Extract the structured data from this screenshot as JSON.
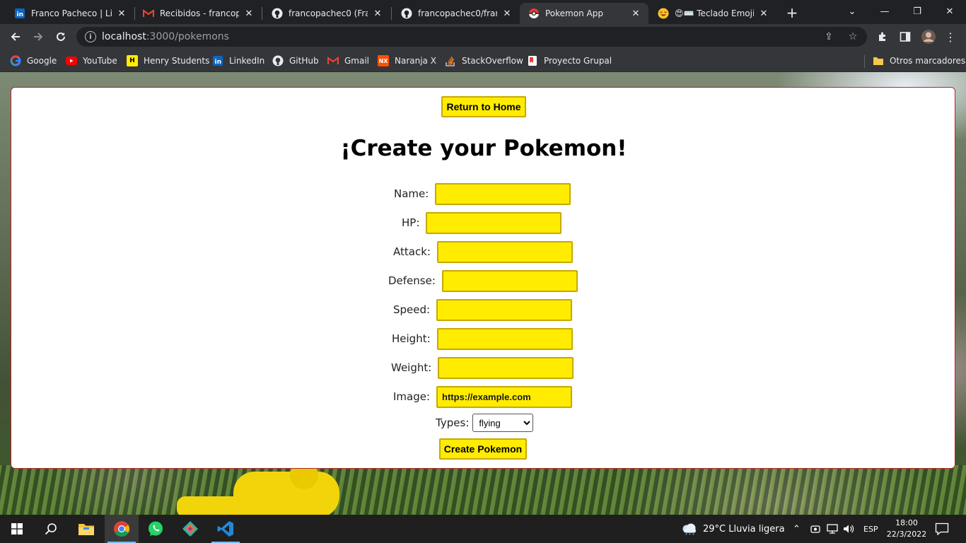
{
  "browser": {
    "tabs": [
      {
        "title": "Franco Pacheco | LinkedIn",
        "icon": "linkedin-icon",
        "active": false
      },
      {
        "title": "Recibidos - francopacheco",
        "icon": "gmail-icon",
        "active": false
      },
      {
        "title": "francopachec0 (Franco Pacheco)",
        "icon": "github-icon",
        "active": false
      },
      {
        "title": "francopachec0/francopachec0",
        "icon": "github-icon",
        "active": false
      },
      {
        "title": "Pokemon App",
        "icon": "pokeball-icon",
        "active": true
      },
      {
        "title": "😍⌨️ Teclado Emoji ¿",
        "icon": "emoji-icon",
        "active": false
      }
    ],
    "url": {
      "host": "localhost",
      "path": ":3000/pokemons"
    },
    "bookmarks": [
      {
        "label": "Google",
        "icon": "google-icon"
      },
      {
        "label": "YouTube",
        "icon": "youtube-icon"
      },
      {
        "label": "Henry Students",
        "icon": "henry-icon"
      },
      {
        "label": "LinkedIn",
        "icon": "linkedin-icon"
      },
      {
        "label": "GitHub",
        "icon": "github-icon"
      },
      {
        "label": "Gmail",
        "icon": "gmail-icon"
      },
      {
        "label": "Naranja X",
        "icon": "naranjax-icon"
      },
      {
        "label": "StackOverflow",
        "icon": "stackoverflow-icon"
      },
      {
        "label": "Proyecto Grupal",
        "icon": "bookmark-icon"
      }
    ],
    "other_bookmarks": "Otros marcadores"
  },
  "page": {
    "home_button": "Return to Home",
    "title": "¡Create your Pokemon!",
    "fields": [
      {
        "label": "Name:",
        "value": "",
        "placeholder": ""
      },
      {
        "label": "HP:",
        "value": "",
        "placeholder": ""
      },
      {
        "label": "Attack:",
        "value": "",
        "placeholder": ""
      },
      {
        "label": "Defense:",
        "value": "",
        "placeholder": ""
      },
      {
        "label": "Speed:",
        "value": "",
        "placeholder": ""
      },
      {
        "label": "Height:",
        "value": "",
        "placeholder": ""
      },
      {
        "label": "Weight:",
        "value": "",
        "placeholder": ""
      },
      {
        "label": "Image:",
        "value": "https://example.com",
        "placeholder": ""
      }
    ],
    "types_label": "Types:",
    "types_selected": "flying",
    "create_button": "Create Pokemon"
  },
  "taskbar": {
    "weather": "29°C  Lluvia ligera",
    "language": "ESP",
    "time": "18:00",
    "date": "22/3/2022"
  },
  "colors": {
    "button_yellow": "#ffec00",
    "card_border": "#b0252a"
  }
}
